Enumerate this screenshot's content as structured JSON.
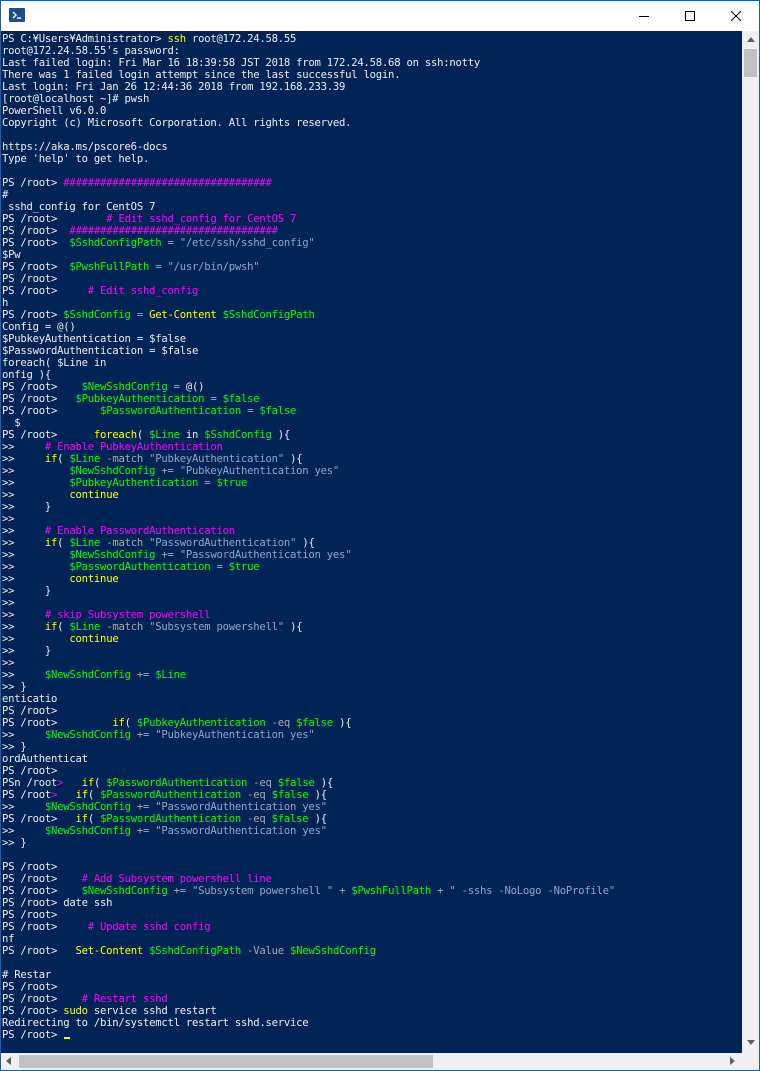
{
  "window": {
    "app_icon": "powershell-icon",
    "controls": [
      "minimize-icon",
      "maximize-icon",
      "close-icon"
    ]
  },
  "colors": {
    "background": "#012456",
    "default": "#eeedf0",
    "command": "#ffff00",
    "comment": "#ff00ff",
    "variable": "#00ff00",
    "operator": "#a8a8a8",
    "string": "#8aa8c8"
  },
  "lines": [
    [
      [
        "d",
        "PS C:¥Users¥Administrator> "
      ],
      [
        "y",
        "ssh"
      ],
      [
        "d",
        " root@172.24.58.55"
      ]
    ],
    [
      [
        "d",
        "root@172.24.58.55's password:"
      ]
    ],
    [
      [
        "d",
        "Last failed login: Fri Mar 16 18:39:58 JST 2018 from 172.24.58.68 on ssh:notty"
      ]
    ],
    [
      [
        "d",
        "There was 1 failed login attempt since the last successful login."
      ]
    ],
    [
      [
        "d",
        "Last login: Fri Jan 26 12:44:36 2018 from 192.168.233.39"
      ]
    ],
    [
      [
        "d",
        "[root@localhost ~]# pwsh"
      ]
    ],
    [
      [
        "d",
        "PowerShell v6.0.0"
      ]
    ],
    [
      [
        "d",
        "Copyright (c) Microsoft Corporation. All rights reserved."
      ]
    ],
    [
      [
        "d",
        ""
      ]
    ],
    [
      [
        "d",
        "https://aka.ms/pscore6-docs"
      ]
    ],
    [
      [
        "d",
        "Type 'help' to get help."
      ]
    ],
    [
      [
        "d",
        ""
      ]
    ],
    [
      [
        "d",
        "PS /root> "
      ],
      [
        "m",
        "##################################"
      ]
    ],
    [
      [
        "d",
        "#"
      ]
    ],
    [
      [
        "d",
        " sshd_config for CentOS 7"
      ]
    ],
    [
      [
        "d",
        "PS /root>        "
      ],
      [
        "m",
        "# Edit sshd_config for CentOS 7"
      ]
    ],
    [
      [
        "d",
        "PS /root>  "
      ],
      [
        "m",
        "##################################"
      ]
    ],
    [
      [
        "d",
        "PS /root>  "
      ],
      [
        "g",
        "$SshdConfigPath"
      ],
      [
        "gr",
        " = "
      ],
      [
        "s",
        "\"/etc/ssh/sshd_config\""
      ]
    ],
    [
      [
        "d",
        "$Pw"
      ]
    ],
    [
      [
        "d",
        "PS /root>  "
      ],
      [
        "g",
        "$PwshFullPath"
      ],
      [
        "gr",
        " = "
      ],
      [
        "s",
        "\"/usr/bin/pwsh\""
      ]
    ],
    [
      [
        "d",
        "PS /root>"
      ]
    ],
    [
      [
        "d",
        "PS /root>     "
      ],
      [
        "m",
        "# Edit sshd_config"
      ]
    ],
    [
      [
        "d",
        "h"
      ]
    ],
    [
      [
        "d",
        "PS /root> "
      ],
      [
        "g",
        "$SshdConfig"
      ],
      [
        "gr",
        " = "
      ],
      [
        "y",
        "Get-Content"
      ],
      [
        "d",
        " "
      ],
      [
        "g",
        "$SshdConfigPath"
      ]
    ],
    [
      [
        "d",
        "Config = @()"
      ]
    ],
    [
      [
        "d",
        "$PubkeyAuthentication = $false"
      ]
    ],
    [
      [
        "d",
        "$PasswordAuthentication = $false"
      ]
    ],
    [
      [
        "d",
        "foreach( $Line in"
      ]
    ],
    [
      [
        "d",
        "onfig ){"
      ]
    ],
    [
      [
        "d",
        "PS /root>    "
      ],
      [
        "g",
        "$NewSshdConfig"
      ],
      [
        "gr",
        " = "
      ],
      [
        "d",
        "@()"
      ]
    ],
    [
      [
        "d",
        "PS /root>   "
      ],
      [
        "g",
        "$PubkeyAuthentication"
      ],
      [
        "gr",
        " = "
      ],
      [
        "g",
        "$false"
      ]
    ],
    [
      [
        "d",
        "PS /root>       "
      ],
      [
        "g",
        "$PasswordAuthentication"
      ],
      [
        "gr",
        " = "
      ],
      [
        "g",
        "$false"
      ]
    ],
    [
      [
        "d",
        "  $"
      ]
    ],
    [
      [
        "d",
        "PS /root>      "
      ],
      [
        "y",
        "foreach"
      ],
      [
        "d",
        "( "
      ],
      [
        "g",
        "$Line"
      ],
      [
        "d",
        " in "
      ],
      [
        "g",
        "$SshdConfig"
      ],
      [
        "d",
        " ){"
      ]
    ],
    [
      [
        "d",
        ">>     "
      ],
      [
        "m",
        "# Enable PubkeyAuthentication"
      ]
    ],
    [
      [
        "d",
        ">>     "
      ],
      [
        "y",
        "if"
      ],
      [
        "d",
        "( "
      ],
      [
        "g",
        "$Line"
      ],
      [
        "gr",
        " -match "
      ],
      [
        "s",
        "\"PubkeyAuthentication\""
      ],
      [
        "d",
        " ){"
      ]
    ],
    [
      [
        "d",
        ">>         "
      ],
      [
        "g",
        "$NewSshdConfig"
      ],
      [
        "gr",
        " += "
      ],
      [
        "s",
        "\"PubkeyAuthentication yes\""
      ]
    ],
    [
      [
        "d",
        ">>         "
      ],
      [
        "g",
        "$PubkeyAuthentication"
      ],
      [
        "gr",
        " = "
      ],
      [
        "g",
        "$true"
      ]
    ],
    [
      [
        "d",
        ">>         "
      ],
      [
        "y",
        "continue"
      ]
    ],
    [
      [
        "d",
        ">>     }"
      ]
    ],
    [
      [
        "d",
        ">>"
      ]
    ],
    [
      [
        "d",
        ">>     "
      ],
      [
        "m",
        "# Enable PasswordAuthentication"
      ]
    ],
    [
      [
        "d",
        ">>     "
      ],
      [
        "y",
        "if"
      ],
      [
        "d",
        "( "
      ],
      [
        "g",
        "$Line"
      ],
      [
        "gr",
        " -match "
      ],
      [
        "s",
        "\"PasswordAuthentication\""
      ],
      [
        "d",
        " ){"
      ]
    ],
    [
      [
        "d",
        ">>         "
      ],
      [
        "g",
        "$NewSshdConfig"
      ],
      [
        "gr",
        " += "
      ],
      [
        "s",
        "\"PasswordAuthentication yes\""
      ]
    ],
    [
      [
        "d",
        ">>         "
      ],
      [
        "g",
        "$PasswordAuthentication"
      ],
      [
        "gr",
        " = "
      ],
      [
        "g",
        "$true"
      ]
    ],
    [
      [
        "d",
        ">>         "
      ],
      [
        "y",
        "continue"
      ]
    ],
    [
      [
        "d",
        ">>     }"
      ]
    ],
    [
      [
        "d",
        ">>"
      ]
    ],
    [
      [
        "d",
        ">>     "
      ],
      [
        "m",
        "# skip Subsystem powershell"
      ]
    ],
    [
      [
        "d",
        ">>     "
      ],
      [
        "y",
        "if"
      ],
      [
        "d",
        "( "
      ],
      [
        "g",
        "$Line"
      ],
      [
        "gr",
        " -match "
      ],
      [
        "s",
        "\"Subsystem powershell\""
      ],
      [
        "d",
        " ){"
      ]
    ],
    [
      [
        "d",
        ">>         "
      ],
      [
        "y",
        "continue"
      ]
    ],
    [
      [
        "d",
        ">>     }"
      ]
    ],
    [
      [
        "d",
        ">>"
      ]
    ],
    [
      [
        "d",
        ">>     "
      ],
      [
        "g",
        "$NewSshdConfig"
      ],
      [
        "gr",
        " += "
      ],
      [
        "g",
        "$Line"
      ]
    ],
    [
      [
        "d",
        ">> }"
      ]
    ],
    [
      [
        "d",
        "enticatio"
      ]
    ],
    [
      [
        "d",
        "PS /root>"
      ]
    ],
    [
      [
        "d",
        "PS /root>         "
      ],
      [
        "y",
        "if"
      ],
      [
        "d",
        "( "
      ],
      [
        "g",
        "$PubkeyAuthentication"
      ],
      [
        "gr",
        " -eq "
      ],
      [
        "g",
        "$false"
      ],
      [
        "d",
        " ){"
      ]
    ],
    [
      [
        "d",
        ">>     "
      ],
      [
        "g",
        "$NewSshdConfig"
      ],
      [
        "gr",
        " += "
      ],
      [
        "s",
        "\"PubkeyAuthentication yes\""
      ]
    ],
    [
      [
        "d",
        ">> }"
      ]
    ],
    [
      [
        "d",
        "ordAuthenticat"
      ]
    ],
    [
      [
        "d",
        "PS /root>"
      ]
    ],
    [
      [
        "d",
        "PSn /root"
      ],
      [
        "m",
        ">"
      ],
      [
        "d",
        "   "
      ],
      [
        "y",
        "if"
      ],
      [
        "d",
        "( "
      ],
      [
        "g",
        "$PasswordAuthentication"
      ],
      [
        "gr",
        " -eq "
      ],
      [
        "g",
        "$false"
      ],
      [
        "d",
        " ){"
      ]
    ],
    [
      [
        "d",
        "PS /root"
      ],
      [
        "m",
        ">"
      ],
      [
        "d",
        "   "
      ],
      [
        "y",
        "if"
      ],
      [
        "d",
        "( "
      ],
      [
        "g",
        "$PasswordAuthentication"
      ],
      [
        "gr",
        " -eq "
      ],
      [
        "g",
        "$false"
      ],
      [
        "d",
        " ){"
      ]
    ],
    [
      [
        "d",
        ">>     "
      ],
      [
        "g",
        "$NewSshdConfig"
      ],
      [
        "gr",
        " += "
      ],
      [
        "s",
        "\"PasswordAuthentication yes\""
      ]
    ],
    [
      [
        "d",
        "PS /root>   "
      ],
      [
        "y",
        "if"
      ],
      [
        "d",
        "( "
      ],
      [
        "g",
        "$PasswordAuthentication"
      ],
      [
        "gr",
        " -eq "
      ],
      [
        "g",
        "$false"
      ],
      [
        "d",
        " ){"
      ]
    ],
    [
      [
        "d",
        ">>     "
      ],
      [
        "g",
        "$NewSshdConfig"
      ],
      [
        "gr",
        " += "
      ],
      [
        "s",
        "\"PasswordAuthentication yes\""
      ]
    ],
    [
      [
        "d",
        ">> }"
      ]
    ],
    [
      [
        "d",
        ""
      ]
    ],
    [
      [
        "d",
        "PS /root>"
      ]
    ],
    [
      [
        "d",
        "PS /root>    "
      ],
      [
        "m",
        "# Add Subsystem powershell line"
      ]
    ],
    [
      [
        "d",
        "PS /root>    "
      ],
      [
        "g",
        "$NewSshdConfig"
      ],
      [
        "gr",
        " += "
      ],
      [
        "s",
        "\"Subsystem powershell \""
      ],
      [
        "gr",
        " + "
      ],
      [
        "g",
        "$PwshFullPath"
      ],
      [
        "gr",
        " + "
      ],
      [
        "s",
        "\" -sshs -NoLogo -NoProfile\""
      ]
    ],
    [
      [
        "d",
        "PS /root> date ssh"
      ]
    ],
    [
      [
        "d",
        "PS /root>"
      ]
    ],
    [
      [
        "d",
        "PS /root>     "
      ],
      [
        "m",
        "# Update sshd config"
      ]
    ],
    [
      [
        "d",
        "nf"
      ]
    ],
    [
      [
        "d",
        "PS /root>   "
      ],
      [
        "y",
        "Set-Content"
      ],
      [
        "d",
        " "
      ],
      [
        "g",
        "$SshdConfigPath"
      ],
      [
        "gr",
        " -Value "
      ],
      [
        "g",
        "$NewSshdConfig"
      ]
    ],
    [
      [
        "d",
        ""
      ]
    ],
    [
      [
        "d",
        "# Restar"
      ]
    ],
    [
      [
        "d",
        "PS /root>"
      ]
    ],
    [
      [
        "d",
        "PS /root>    "
      ],
      [
        "m",
        "# Restart sshd"
      ]
    ],
    [
      [
        "d",
        "PS /root> "
      ],
      [
        "y",
        "sudo"
      ],
      [
        "d",
        " service sshd restart"
      ]
    ],
    [
      [
        "d",
        "Redirecting to /bin/systemctl restart sshd.service"
      ]
    ],
    [
      [
        "d",
        "PS /root> "
      ]
    ]
  ]
}
